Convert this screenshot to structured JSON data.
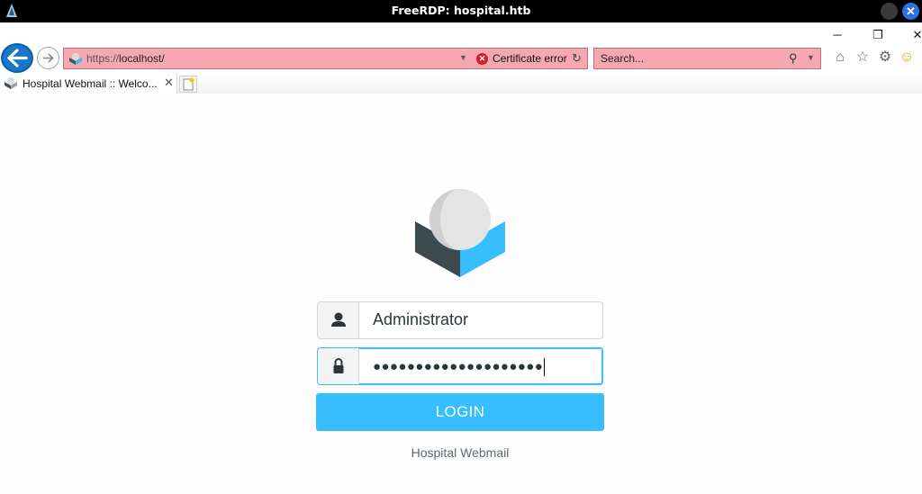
{
  "rdp": {
    "title": "FreeRDP: hospital.htb",
    "close_glyph": "✕"
  },
  "browser": {
    "address": {
      "protocol": "https://",
      "host": "localhost/",
      "cert_error": "Certificate error",
      "cert_glyph": "✕",
      "refresh_glyph": "↻",
      "dropdown_glyph": "▼"
    },
    "search": {
      "placeholder": "Search...",
      "search_glyph": "⚲",
      "dropdown_glyph": "▼"
    },
    "window": {
      "minimize_glyph": "─",
      "restore_glyph": "❐",
      "close_glyph": "✕"
    },
    "tools": {
      "home_glyph": "⌂",
      "favorites_glyph": "☆",
      "settings_glyph": "⚙",
      "feedback_glyph": "☺"
    },
    "tab": {
      "title": "Hospital Webmail :: Welco...",
      "close_glyph": "✕"
    }
  },
  "login": {
    "username": "Administrator",
    "password_mask": "●●●●●●●●●●●●●●●●●●●●",
    "button_label": "LOGIN",
    "product_name": "Hospital Webmail"
  },
  "colors": {
    "accent": "#37beff",
    "address_error": "#f5a7b2",
    "back_button": "#1a76c6",
    "logo_dark": "#3c4a50"
  },
  "icons": [
    "freerdp-icon",
    "back-arrow-icon",
    "forward-arrow-icon",
    "site-favicon-icon",
    "certificate-error-icon",
    "refresh-icon",
    "search-icon",
    "home-icon",
    "favorites-star-icon",
    "settings-gear-icon",
    "smiley-feedback-icon",
    "new-tab-icon",
    "user-icon",
    "lock-icon",
    "roundcube-logo-icon"
  ]
}
